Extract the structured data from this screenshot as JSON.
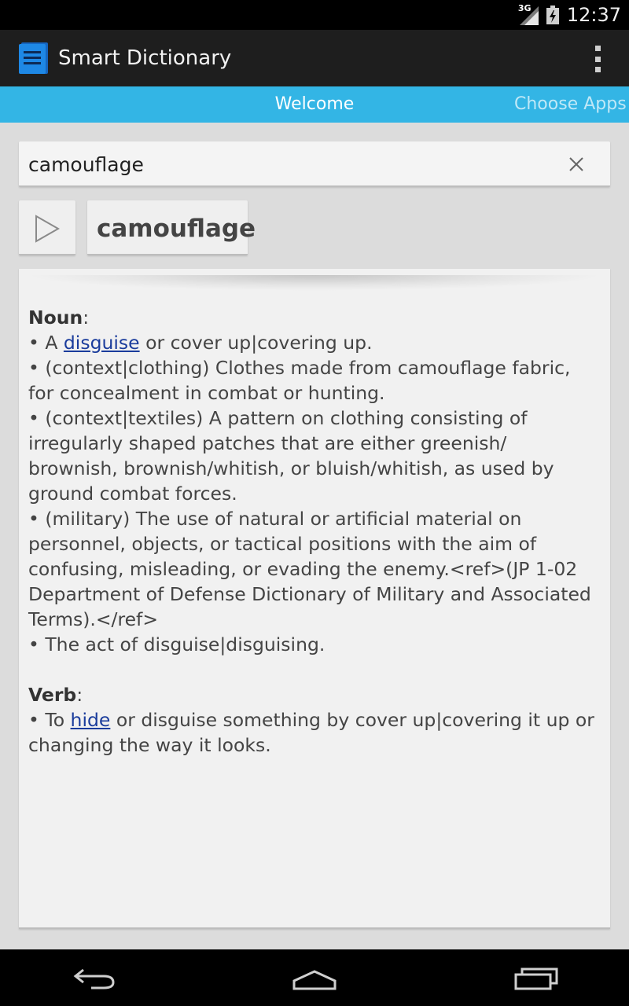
{
  "status_bar": {
    "network": "3G",
    "time": "12:37"
  },
  "action_bar": {
    "title": "Smart Dictionary"
  },
  "tabs": [
    {
      "label": "Welcome"
    },
    {
      "label": "Choose Apps"
    }
  ],
  "search": {
    "value": "camouflage"
  },
  "word": {
    "label": "camouflage"
  },
  "definition": {
    "noun": {
      "heading": "Noun",
      "colon": ":",
      "items": [
        {
          "before": "• A ",
          "link": "disguise",
          "after": " or cover up|covering up."
        },
        {
          "text": "• (context|clothing) Clothes made from camouflage fabric, for concealment in combat or hunting."
        },
        {
          "text": "• (context|textiles) A pattern on clothing consisting of irregularly shaped patches that are either greenish/ brownish, brownish/whitish, or bluish/whitish, as used by ground combat forces."
        },
        {
          "text": "• (military) The use of natural or artificial material on personnel, objects, or tactical positions with the aim of confusing, misleading, or evading the enemy.<ref>(JP 1-02 Department of Defense Dictionary of Military and Associated Terms).</ref>"
        },
        {
          "text": "• The act of disguise|disguising."
        }
      ]
    },
    "verb": {
      "heading": "Verb",
      "colon": ":",
      "items": [
        {
          "before": "• To ",
          "link": "hide",
          "after": " or disguise something  by cover up|covering it up or changing the way it looks."
        }
      ]
    }
  },
  "colors": {
    "accent": "#33b5e5",
    "action_bar": "#1e1e1e",
    "link": "#1a3c9c"
  }
}
